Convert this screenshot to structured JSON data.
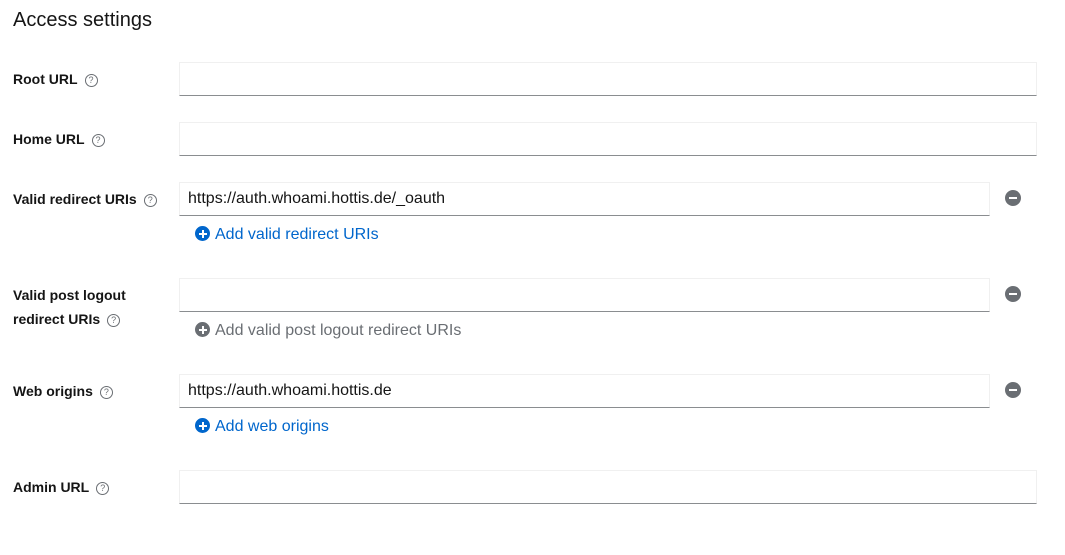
{
  "section": {
    "title": "Access settings"
  },
  "fields": {
    "root_url": {
      "label": "Root URL",
      "value": ""
    },
    "home_url": {
      "label": "Home URL",
      "value": ""
    },
    "valid_redirect_uris": {
      "label": "Valid redirect URIs",
      "value": "https://auth.whoami.hottis.de/_oauth",
      "add_label": "Add valid redirect URIs"
    },
    "valid_post_logout": {
      "label_line1": "Valid post logout",
      "label_line2": "redirect URIs",
      "value": "",
      "add_label": "Add valid post logout redirect URIs"
    },
    "web_origins": {
      "label": "Web origins",
      "value": "https://auth.whoami.hottis.de",
      "add_label": "Add web origins"
    },
    "admin_url": {
      "label": "Admin URL",
      "value": ""
    }
  },
  "icons": {
    "help": "?"
  }
}
